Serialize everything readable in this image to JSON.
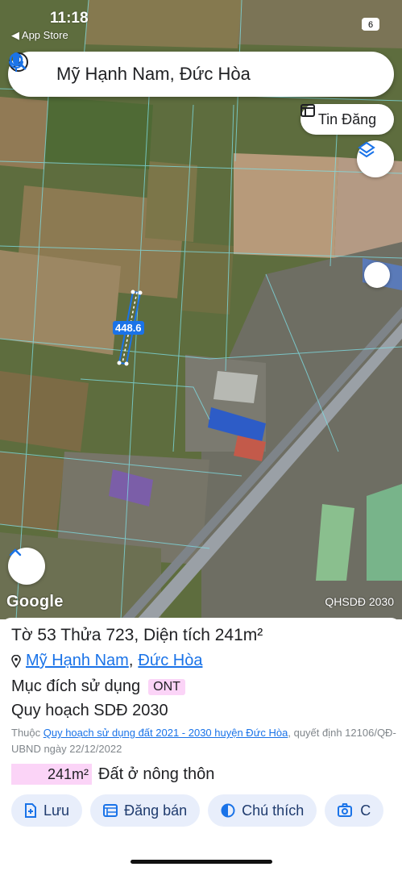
{
  "status": {
    "time": "11:18",
    "back_label": "App Store"
  },
  "search": {
    "text": "Mỹ Hạnh Nam, Đức Hòa"
  },
  "map": {
    "tin_dang_label": "Tin Đăng",
    "measure_label": "48.6",
    "measure_prefix": "4",
    "google_logo": "Google",
    "layer_label": "QHSDĐ 2030"
  },
  "sheet": {
    "title": "Tờ 53 Thửa 723, Diện tích 241m²",
    "location_commune": "Mỹ Hạnh Nam",
    "location_sep": ",",
    "location_district": "Đức Hòa",
    "purpose_label": "Mục đích sử dụng",
    "purpose_code": "ONT",
    "plan_label": "Quy hoạch SDĐ 2030",
    "note_prefix": "Thuộc ",
    "note_link": "Quy hoạch sử dụng đất 2021 - 2030 huyện Đức Hòa",
    "note_suffix": ", quyết định 12106/QĐ-UBND ngày 22/12/2022",
    "area_value": "241m²",
    "area_label": "Đất ở nông thôn",
    "actions": [
      {
        "label": "Lưu",
        "icon": "save-icon"
      },
      {
        "label": "Đăng bán",
        "icon": "list-icon"
      },
      {
        "label": "Chú thích",
        "icon": "contrast-icon"
      },
      {
        "label": "C",
        "icon": "camera-icon"
      }
    ]
  },
  "colors": {
    "accent": "#1a73e8",
    "badge_pink": "#fbd4f7",
    "action_bg": "#e8eefb"
  }
}
